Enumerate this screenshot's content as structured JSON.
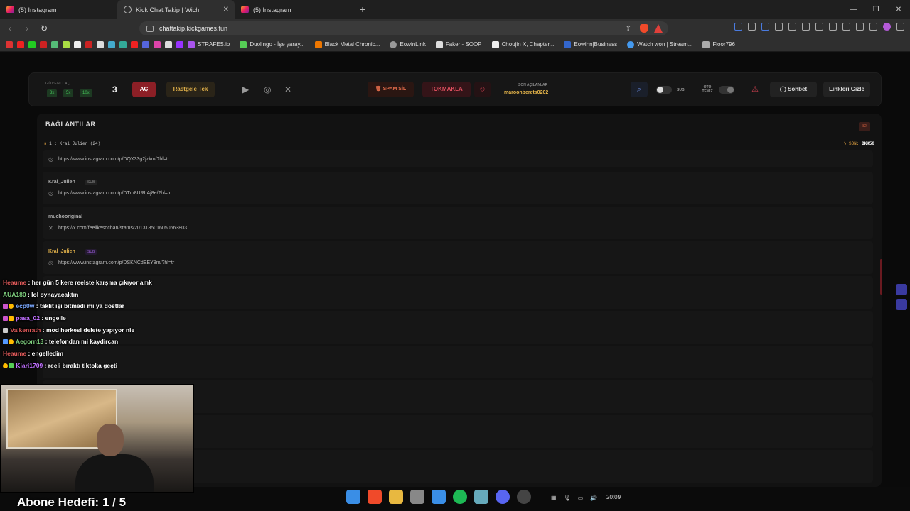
{
  "tabs": [
    {
      "label": "(5) Instagram",
      "active": false
    },
    {
      "label": "Kick Chat Takip | Wich",
      "active": true
    },
    {
      "label": "(5) Instagram",
      "active": false
    }
  ],
  "url": "chattakip.kickgames.fun",
  "bookmarks": [
    "STRAFES.io",
    "Duolingo - İşe yaray...",
    "Black Metal Chronic...",
    "EowinLink",
    "Faker - SOOP",
    "Choujin X, Chapter...",
    "Eowinn|Business",
    "Watch won | Stream...",
    "Floor796"
  ],
  "controls": {
    "guvenli_label": "GÜVENLİ AÇ",
    "mult": [
      "3x",
      "5x",
      "10x"
    ],
    "count": "3",
    "ac": "AÇ",
    "rastgele": "Rastgele Tek",
    "spam": "SPAM SİL",
    "tokmakla": "TOKMAKLA",
    "son_label": "SON AÇILANLAR",
    "son_user": "maroonberets0202",
    "sub_label": "SUB",
    "oto_label": "OTO TEMİZ",
    "sohbet": "Sohbet",
    "linkleri": "Linkleri Gizle"
  },
  "panel": {
    "title": "BAĞLANTILAR",
    "badge": "82",
    "pinned_left": "1.: Kral_Julien (24)",
    "pinned_right_label": "SON:",
    "pinned_right_value": "BKK50"
  },
  "rows": [
    {
      "user": "",
      "link": "https://www.instagram.com/p/DQX33g2jzkm/?hl=tr",
      "icon": "instagram-icon"
    },
    {
      "user": "Kral_Julien",
      "sub": "SUB",
      "link": "https://www.instagram.com/p/DTm8URLAj8e/?hl=tr",
      "icon": "instagram-icon"
    },
    {
      "user": "muchooriginal",
      "link": "https://x.com/feelikesochan/status/2013185016050663803",
      "icon": "x-icon"
    },
    {
      "user": "Kral_Julien",
      "sub": "SUB",
      "link": "https://www.instagram.com/p/DSKNCdEEY8m/?hl=tr",
      "icon": "instagram-icon"
    }
  ],
  "chat": [
    {
      "name": "Heaume",
      "text": "her gün 5 kere reelste karşma çıkıyor amk"
    },
    {
      "name": "AUA180",
      "text": "lol oynayacaktın"
    },
    {
      "name": "ecp0w",
      "text": "taklit işi bitmedi mi ya dostlar"
    },
    {
      "name": "pasa_02",
      "text": "engelle"
    },
    {
      "name": "Valkenrath",
      "text": "mod herkesi delete yapıyor nie"
    },
    {
      "name": "Aegorn13",
      "text": "telefondan mi kaydircan"
    },
    {
      "name": "Heaume",
      "text": "engelledim"
    },
    {
      "name": "Kiari1709",
      "text": "reeli bıraktı tiktoka geçti"
    }
  ],
  "goal": "Abone Hedefi:   1 / 5",
  "clock": "20:09"
}
